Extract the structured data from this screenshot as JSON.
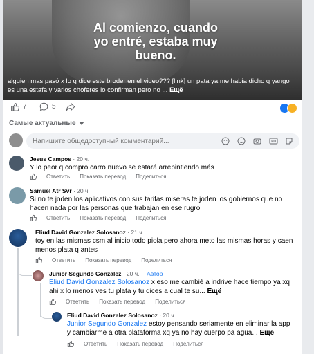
{
  "video": {
    "overlay_text": "Al comienzo, cuando yo entré, estaba muy bueno.",
    "caption": "alguien mas pasó x lo q dice este broder en el video??? [link] un pata ya me habia dicho q yango es una estafa y varios choferes lo confirman pero no ...",
    "caption_more": "Ещё"
  },
  "reactions": {
    "likes": "7",
    "comments": "5"
  },
  "sort": {
    "label": "Самые актуальные"
  },
  "composer": {
    "placeholder": "Напишите общедоступный комментарий..."
  },
  "actions": {
    "reply": "Ответить",
    "translate": "Показать перевод",
    "share": "Поделиться"
  },
  "comments": [
    {
      "name": "Jesus Campos",
      "time": " · 20 ч.",
      "text": "Y lo peor q compro carro nuevo se estará arrepintiendo más"
    },
    {
      "name": "Samuel Atr Svr",
      "time": " · 20 ч.",
      "text": "Si no te joden los aplicativos con sus tarifas miseras te joden los gobiernos que no hacen nada por las personas que trabajan en ese rugro"
    },
    {
      "name": "Eliud David Gonzalez Solosanoz",
      "time": " · 21 ч.",
      "text": "toy en las mismas csm al inicio todo piola pero ahora meto las mismas horas y caen menos plata q antes"
    },
    {
      "name": "Junior Segundo Gonzalez",
      "time": " · 20 ч. · ",
      "badge": "Автор",
      "mention": "Eliud David Gonzalez Solosanoz",
      "text": " x eso me cambié a indrive hace tiempo ya xq ahi x lo menos ves tu plata y tu dices a cual te su...",
      "more": "Ещё"
    },
    {
      "name": "Eliud David Gonzalez Solosanoz",
      "time": " · 20 ч.",
      "mention": "Junior Segundo Gonzalez",
      "text": " estoy pensando seriamente en eliminar la app y cambiarme a otra plataforma xq ya no hay cuerpo pa agua...",
      "more": "Ещё"
    }
  ],
  "colors": {
    "accent": "#1877f2",
    "secondary_text": "#65676b",
    "background": "#e4e6ea"
  },
  "icons": [
    "like-icon",
    "comment-icon",
    "share-icon",
    "chevron-down-icon",
    "sticker-icon",
    "emoji-icon",
    "camera-icon",
    "gif-icon",
    "stickers-icon"
  ]
}
